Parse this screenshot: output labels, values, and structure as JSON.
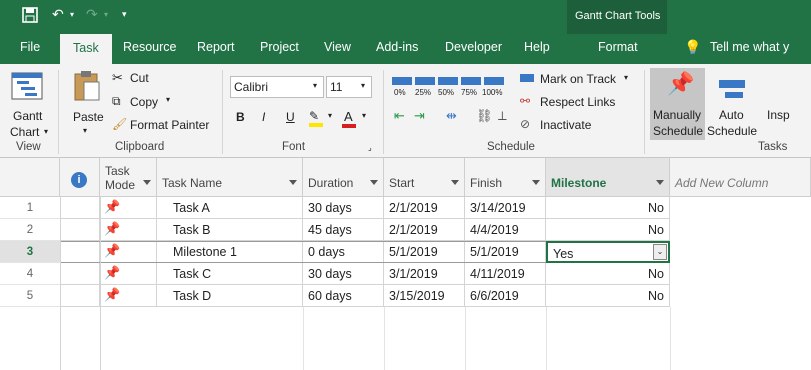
{
  "window": {
    "context_title": "Gantt Chart Tools"
  },
  "tabs": [
    "File",
    "Task",
    "Resource",
    "Report",
    "Project",
    "View",
    "Add-ins",
    "Developer",
    "Help",
    "Format"
  ],
  "tell_me": "Tell me what y",
  "ribbon": {
    "view_group": {
      "gantt_label_1": "Gantt",
      "gantt_label_2": "Chart",
      "label": "View"
    },
    "clipboard": {
      "paste": "Paste",
      "cut": "Cut",
      "copy": "Copy",
      "format_painter": "Format Painter",
      "label": "Clipboard"
    },
    "font": {
      "family": "Calibri",
      "size": "11",
      "label": "Font",
      "bold": "B",
      "italic": "I",
      "underline": "U",
      "font_color_glyph": "A"
    },
    "schedule": {
      "pct": [
        "0%",
        "25%",
        "50%",
        "75%",
        "100%"
      ],
      "mark_on_track": "Mark on Track",
      "respect_links": "Respect Links",
      "inactivate": "Inactivate",
      "label": "Schedule"
    },
    "tasks": {
      "manually": "Manually",
      "manually_2": "Schedule",
      "auto": "Auto",
      "auto_2": "Schedule",
      "inspect": "Insp",
      "label": "Tasks"
    }
  },
  "table": {
    "columns": [
      "Task Mode",
      "Task Name",
      "Duration",
      "Start",
      "Finish",
      "Milestone",
      "Add New Column"
    ],
    "task_mode_1": "Task",
    "task_mode_2": "Mode",
    "rows": [
      {
        "id": "1",
        "name": "Task A",
        "duration": "30 days",
        "start": "2/1/2019",
        "finish": "3/14/2019",
        "milestone": "No"
      },
      {
        "id": "2",
        "name": "Task B",
        "duration": "45 days",
        "start": "2/1/2019",
        "finish": "4/4/2019",
        "milestone": "No"
      },
      {
        "id": "3",
        "name": "Milestone 1",
        "duration": "0 days",
        "start": "5/1/2019",
        "finish": "5/1/2019",
        "milestone": "Yes"
      },
      {
        "id": "4",
        "name": "Task C",
        "duration": "30 days",
        "start": "3/1/2019",
        "finish": "4/11/2019",
        "milestone": "No"
      },
      {
        "id": "5",
        "name": "Task D",
        "duration": "60 days",
        "start": "3/15/2019",
        "finish": "6/6/2019",
        "milestone": "No"
      }
    ]
  },
  "colors": {
    "accent": "#217346",
    "pin": "#2ea3c9",
    "milestone_header": "#217346"
  }
}
